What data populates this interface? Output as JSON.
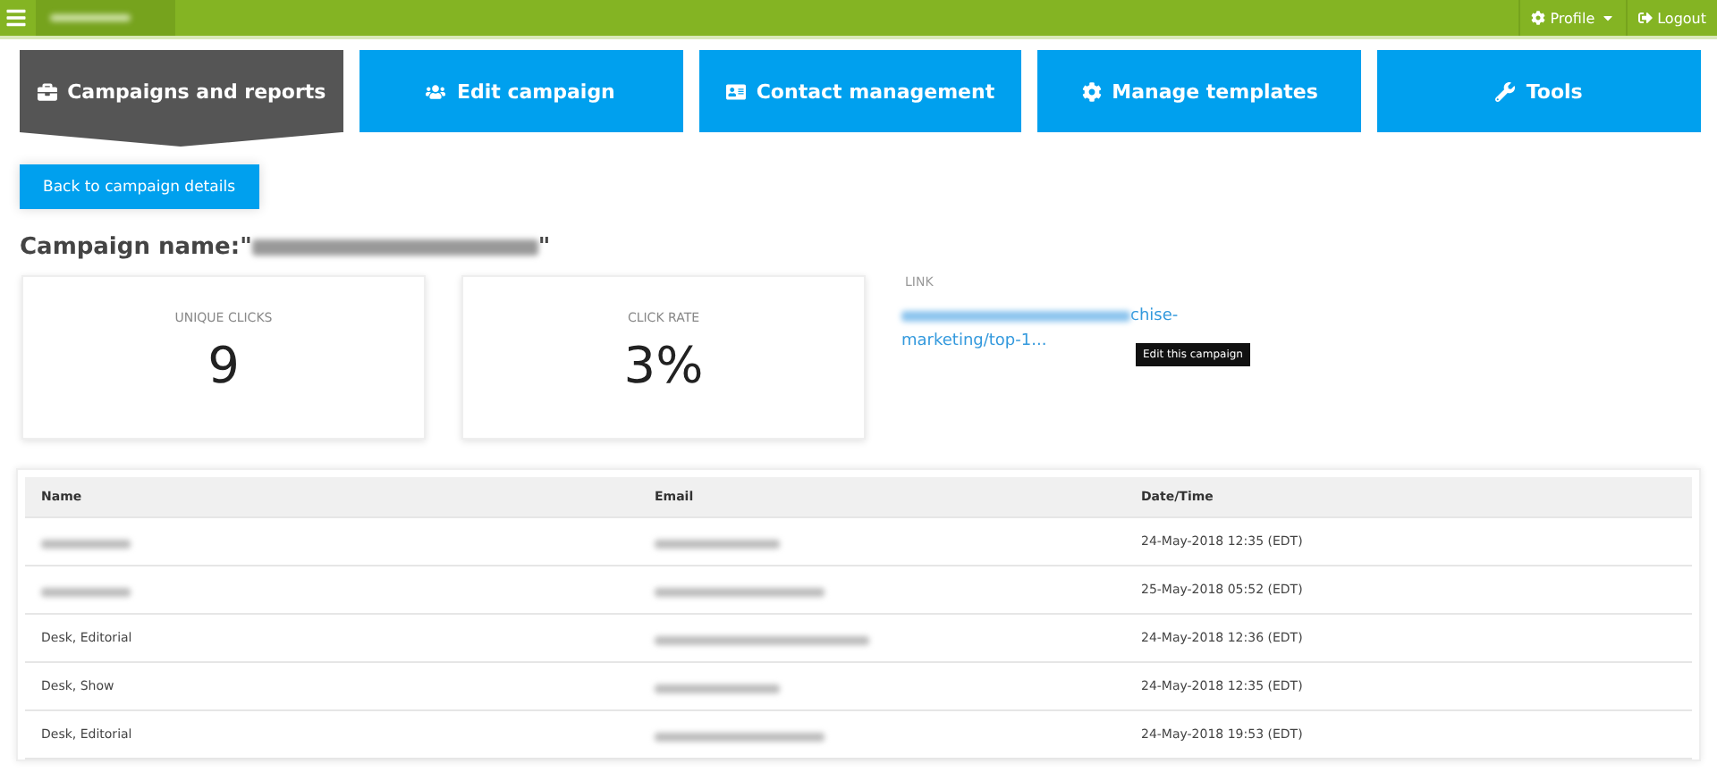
{
  "topbar": {
    "profile": "Profile",
    "logout": "Logout"
  },
  "tabs": [
    {
      "label": "Campaigns and reports",
      "selected": true
    },
    {
      "label": "Edit campaign",
      "selected": false
    },
    {
      "label": "Contact management",
      "selected": false
    },
    {
      "label": "Manage templates",
      "selected": false
    },
    {
      "label": "Tools",
      "selected": false
    }
  ],
  "back_button": "Back to campaign details",
  "campaign": {
    "prefix": "Campaign name:\"",
    "suffix": "\""
  },
  "stats": [
    {
      "label": "UNIQUE CLICKS",
      "value": "9"
    },
    {
      "label": "CLICK RATE",
      "value": "3%"
    }
  ],
  "link": {
    "label": "LINK",
    "text": "chise-marketing/top-1..."
  },
  "tooltip": "Edit this campaign",
  "table": {
    "columns": [
      "Name",
      "Email",
      "Date/Time"
    ],
    "rows": [
      {
        "date": "24-May-2018 12:35 (EDT)"
      },
      {
        "date": "25-May-2018 05:52 (EDT)"
      },
      {
        "name": "Desk, Editorial",
        "date": "24-May-2018 12:36 (EDT)"
      },
      {
        "name": "Desk, Show",
        "date": "24-May-2018 12:35 (EDT)"
      },
      {
        "name": "Desk, Editorial",
        "date": "24-May-2018 19:53 (EDT)"
      }
    ]
  }
}
